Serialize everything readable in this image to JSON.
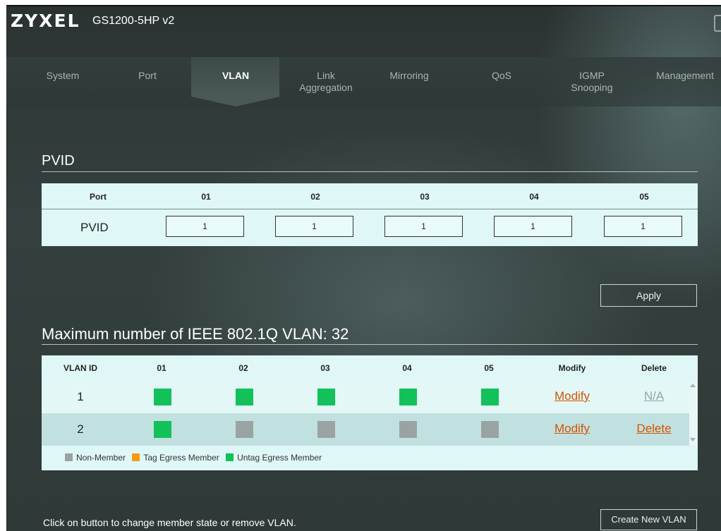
{
  "header": {
    "brand": "ZYXEL",
    "model": "GS1200-5HP v2",
    "exit_icon": "logout-icon"
  },
  "nav": {
    "tabs": [
      {
        "label": "System"
      },
      {
        "label": "Port"
      },
      {
        "label": "VLAN",
        "active": true
      },
      {
        "label": "Link\nAggregation"
      },
      {
        "label": "Mirroring"
      },
      {
        "label": "QoS"
      },
      {
        "label": "IGMP\nSnooping"
      },
      {
        "label": "Management"
      }
    ]
  },
  "pvid": {
    "title": "PVID",
    "header_port": "Port",
    "ports": [
      "01",
      "02",
      "03",
      "04",
      "05"
    ],
    "row_label": "PVID",
    "values": [
      "1",
      "1",
      "1",
      "1",
      "1"
    ]
  },
  "apply_label": "Apply",
  "vlan": {
    "title": "Maximum number of IEEE 802.1Q VLAN: 32",
    "headers": {
      "vlan_id": "VLAN ID",
      "modify": "Modify",
      "delete": "Delete"
    },
    "ports": [
      "01",
      "02",
      "03",
      "04",
      "05"
    ],
    "rows": [
      {
        "id": "1",
        "members": [
          "untag",
          "untag",
          "untag",
          "untag",
          "untag"
        ],
        "modify": "Modify",
        "delete": "N/A"
      },
      {
        "id": "2",
        "members": [
          "untag",
          "non",
          "non",
          "non",
          "non"
        ],
        "modify": "Modify",
        "delete": "Delete"
      }
    ],
    "legend": {
      "non": "Non-Member",
      "tag": "Tag Egress Member",
      "untag": "Untag Egress Member"
    }
  },
  "colors": {
    "untag": "#12c15a",
    "tag": "#f39c12",
    "non": "#9aa3a3",
    "link_orange": "#d35400",
    "link_disabled": "#8fa6a6"
  },
  "footer": {
    "hint": "Click on button to change member state or remove VLAN.",
    "create_label": "Create New VLAN"
  }
}
